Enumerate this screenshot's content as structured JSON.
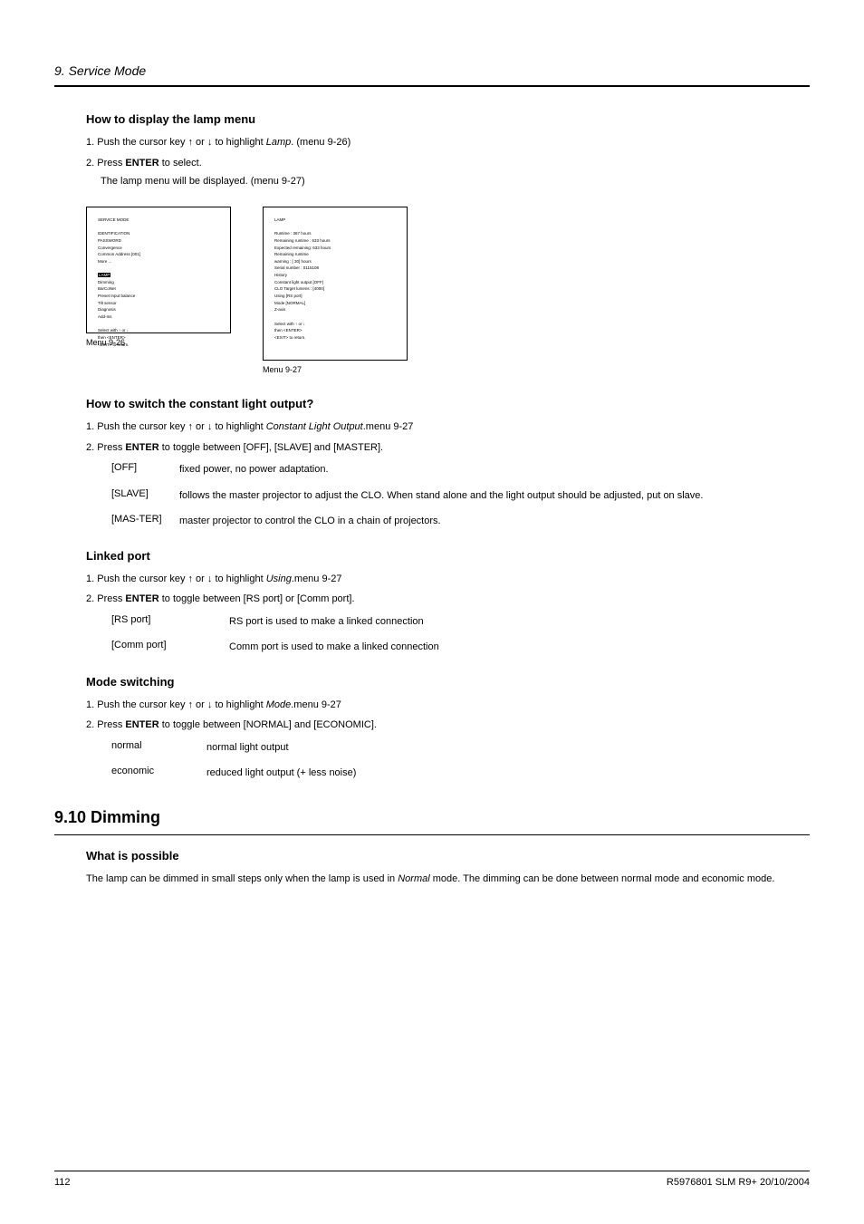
{
  "header": {
    "section": "9.  Service Mode"
  },
  "s1": {
    "title": "How to display the lamp menu",
    "step1_pre": "1.  Push the cursor key ↑ or ↓ to highlight ",
    "step1_em": "Lamp",
    "step1_post": ".  (menu 9-26)",
    "step2_pre": "2.  Press ",
    "step2_b": "ENTER",
    "step2_post": " to select.",
    "step2_sub": "The lamp menu will be displayed.  (menu 9-27)"
  },
  "menu26": {
    "text": "SERVICE MODE\n\nIDENTIFICATION\nPASSWORD\nConvergence\nCommon Address    [001]\nMore ...\n\nLAMP\nDimming\nBarCoNet\nPreset Input balance\nTilt sensor\nDiagnosis\nAdd-Ins\n\nSelect with ↑ or ↓\nthen <ENTER>\n<EXIT> to return.",
    "highlight": "LAMP",
    "label": "Menu 9-26"
  },
  "menu27": {
    "text": "LAMP\n\nRuntime           :    367 hours\nRemaining runtime :    633 hours\nExpected remaining:    633 hours\nRemaining runtime\nwarning           :  [ 30] hours\nSerial number     :  0115108\nHistory\nConstant light output [OFF]\nCLO Target lumens : [4000]\nUsing [RS port]\nMode  [NORMAL]\nZ-axis\n\nSelect with ↑ or ↓\nthen <ENTER>\n<EXIT> to return.",
    "label": "Menu 9-27"
  },
  "s2": {
    "title": "How to switch the constant light output?",
    "step1_pre": "1.  Push the cursor key ↑ or ↓ to highlight ",
    "step1_em": "Constant Light Output",
    "step1_post": ".menu 9-27",
    "step2_pre": "2.  Press ",
    "step2_b": "ENTER",
    "step2_post": " to toggle between [OFF], [SLAVE] and [MASTER].",
    "defs": [
      {
        "term": "[OFF]",
        "desc": "fixed power, no power adaptation."
      },
      {
        "term": "[SLAVE]",
        "desc": "follows the master projector to adjust the CLO. When stand alone and the light output should be adjusted, put on slave."
      },
      {
        "term": "[MAS-TER]",
        "desc": "master projector to control the CLO in a chain of projectors."
      }
    ]
  },
  "s3": {
    "title": "Linked port",
    "step1_pre": "1.  Push the cursor key ↑ or ↓ to highlight ",
    "step1_em": "Using",
    "step1_post": ".menu 9-27",
    "step2_pre": "2.  Press ",
    "step2_b": "ENTER",
    "step2_post": " to toggle between [RS port] or [Comm port].",
    "defs": [
      {
        "term": "[RS port]",
        "desc": "RS port is used to make a linked connection"
      },
      {
        "term": "[Comm port]",
        "desc": "Comm port is used to make a linked connection"
      }
    ]
  },
  "s4": {
    "title": "Mode switching",
    "step1_pre": "1.  Push the cursor key ↑ or ↓ to highlight ",
    "step1_em": "Mode",
    "step1_post": ".menu 9-27",
    "step2_pre": "2.  Press ",
    "step2_b": "ENTER",
    "step2_post": " to toggle between [NORMAL] and [ECONOMIC].",
    "defs": [
      {
        "term": "normal",
        "desc": "normal light output"
      },
      {
        "term": "economic",
        "desc": "reduced light output (+ less noise)"
      }
    ]
  },
  "section910": {
    "heading": "9.10 Dimming",
    "sub": "What is possible",
    "para_pre": "The lamp can be dimmed in small steps only when the lamp is used in ",
    "para_em": "Normal",
    "para_post": " mode.  The dimming can be done between normal mode and economic mode."
  },
  "footer": {
    "page": "112",
    "right": "R5976801  SLM R9+  20/10/2004"
  }
}
